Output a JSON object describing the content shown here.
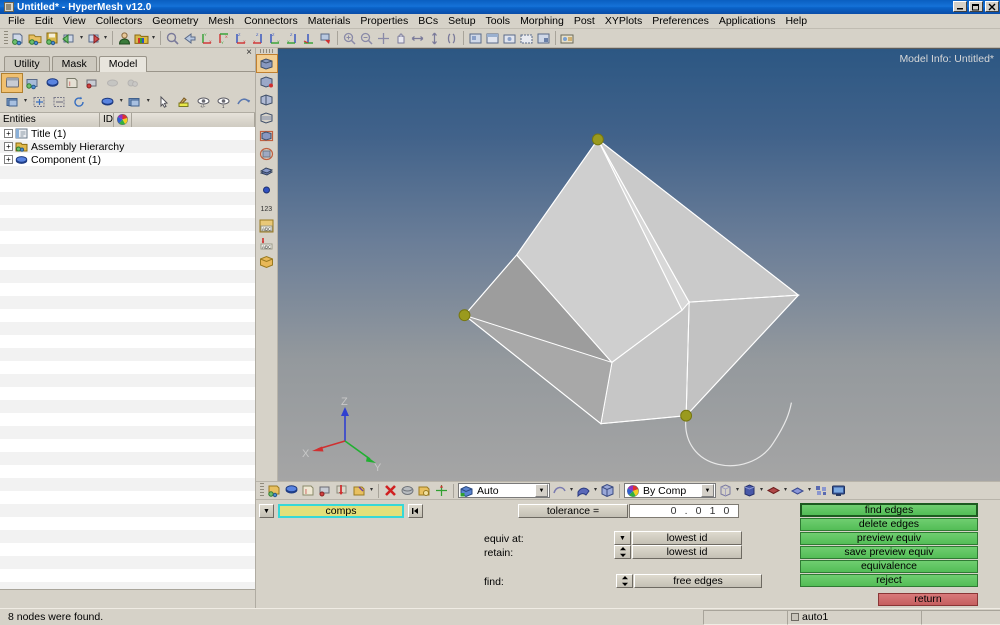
{
  "window": {
    "title": "Untitled* - HyperMesh v12.0",
    "app_icon": "window-icon",
    "minimize": "_",
    "restore": "❐",
    "close": "×",
    "panel_close": "×"
  },
  "menu": {
    "items": [
      {
        "label": "File"
      },
      {
        "label": "Edit"
      },
      {
        "label": "View"
      },
      {
        "label": "Collectors"
      },
      {
        "label": "Geometry"
      },
      {
        "label": "Mesh"
      },
      {
        "label": "Connectors"
      },
      {
        "label": "Materials"
      },
      {
        "label": "Properties"
      },
      {
        "label": "BCs"
      },
      {
        "label": "Setup"
      },
      {
        "label": "Tools"
      },
      {
        "label": "Morphing"
      },
      {
        "label": "Post"
      },
      {
        "label": "XYPlots"
      },
      {
        "label": "Preferences"
      },
      {
        "label": "Applications"
      },
      {
        "label": "Help"
      }
    ]
  },
  "main_toolbar": {
    "groups": [
      [
        "new-model-icon",
        "open-model-icon",
        "save-model-icon",
        "import-icon",
        "export-icon"
      ],
      [
        "user-profile-icon",
        "color-palette-icon"
      ],
      [
        "zoom-icon",
        "back-arrow-icon",
        "axis-yx-icon",
        "axis-xy-icon",
        "axis-zx-icon",
        "axis-xz-icon",
        "axis-zy-icon",
        "axis-yz-icon",
        "axis-rotate-icon",
        "flag-icon"
      ],
      [
        "zoom-in-icon",
        "zoom-out-icon",
        "fit-icon",
        "pan-hand-icon",
        "arrows-horizontal-icon",
        "arrows-vertical-icon",
        "brackets-icon"
      ],
      [
        "view-save-icon",
        "view-restore-icon",
        "view-iso-icon",
        "view-front-icon",
        "view-named-icon"
      ],
      [
        "screenshot-icon"
      ]
    ]
  },
  "left_panel": {
    "tabs": [
      {
        "label": "Utility",
        "active": false
      },
      {
        "label": "Mask",
        "active": false
      },
      {
        "label": "Model",
        "active": true
      }
    ],
    "toolbar_row1": [
      "model-browser-icon",
      "assembly-icon",
      "component-icon",
      "include-icon",
      "solver-icon",
      "disabled-entity-icon",
      "disabled-set-icon"
    ],
    "toolbar_row2": [
      "folder-dropdown-icon",
      "expand-all-icon",
      "collapse-all-icon",
      "refresh-icon",
      "display-component-icon",
      "display-folder-icon",
      "pick-arrow-icon",
      "highlight-icon",
      "show-all-icon",
      "show-one-icon",
      "reverse-icon"
    ],
    "columns": [
      {
        "label": "Entities"
      },
      {
        "label": "ID"
      },
      {
        "label": "color-wheel-icon"
      }
    ],
    "tree": [
      {
        "label": "Title (1)",
        "icon": "title-icon",
        "expander": "+"
      },
      {
        "label": "Assembly Hierarchy",
        "icon": "assembly-hierarchy-icon",
        "expander": "+"
      },
      {
        "label": "Component (1)",
        "icon": "component-icon",
        "expander": "+"
      }
    ]
  },
  "vertical_toolbar": {
    "items": [
      "shaded-geometry-icon",
      "wireframe-geometry-icon",
      "shaded-elements-icon",
      "mesh-lines-icon",
      "feature-lines-icon",
      "transparency-icon",
      "surfaces-icon",
      "node-display-icon",
      "numbers-123-icon",
      "abc-panel-icon",
      "abc-label-icon",
      "mesh-fill-icon"
    ]
  },
  "graphics": {
    "model_info": "Model Info: Untitled*",
    "axis_triad": {
      "x": "X",
      "y": "Y",
      "z": "Z"
    },
    "background_top": "#2c5783",
    "background_bottom": "#a5a5a5",
    "node_color": "#9a9a1e",
    "surface_color": "#c8c8c8"
  },
  "bottom_toolbar": {
    "icons_left": [
      "geom-create-icon",
      "geom-edit-icon",
      "geom-delete-icon",
      "geom-temp-icon",
      "node-edit-icon",
      "line-edit-icon"
    ],
    "icons_mid": [
      "delete-x-icon",
      "shrink-icon",
      "organize-icon",
      "translate-icon"
    ],
    "mesh_mode": {
      "value": "Auto",
      "icon": "mesh-mode-icon"
    },
    "icons_right1": [
      "line-display-icon",
      "surface-display-icon",
      "solid-display-icon"
    ],
    "color_mode": {
      "value": "By Comp",
      "icon": "color-by-icon"
    },
    "icons_right2": [
      "wire-box-icon",
      "solid-box-icon",
      "diamond-icon",
      "plane-icon",
      "mesh-grid-icon",
      "monitor-icon"
    ]
  },
  "panel": {
    "entity_selector": {
      "dropdown_arrow": "▼",
      "value": "comps",
      "reset_icon": "⏮"
    },
    "tolerance": {
      "label": "tolerance =",
      "value": "0 . 0 1 0"
    },
    "fields": [
      {
        "label": "equiv at:",
        "control": "dropdown",
        "value": "lowest id",
        "glyph": "▼"
      },
      {
        "label": "retain:",
        "control": "spinner",
        "value": "lowest id",
        "glyph": "↕"
      },
      {
        "label": "find:",
        "control": "spinner",
        "value": "free edges",
        "glyph": "↕"
      }
    ],
    "action_buttons": [
      {
        "label": "find edges",
        "primary": true
      },
      {
        "label": "delete edges",
        "primary": false
      },
      {
        "label": "preview equiv",
        "primary": false
      },
      {
        "label": "save preview equiv",
        "primary": false
      },
      {
        "label": "equivalence",
        "primary": false
      },
      {
        "label": "reject",
        "primary": false
      }
    ],
    "return_button": {
      "label": "return"
    }
  },
  "statusbar": {
    "message": "8 nodes were found.",
    "field_left": "",
    "field_mid": "auto1",
    "field_right": ""
  },
  "colors": {
    "green_button": "#5ec261",
    "red_button": "#cc6a6a",
    "title_blue": "#0a63c8",
    "panel_bg": "#d6d2c8",
    "comps_yellow": "#e3e07a",
    "comps_border": "#36d8d8"
  }
}
